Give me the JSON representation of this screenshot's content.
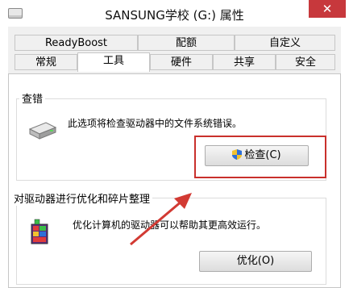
{
  "window": {
    "title": "SANSUNG学校 (G:) 属性",
    "close_label": "✕"
  },
  "tabs_row1": [
    "ReadyBoost",
    "配额",
    "自定义"
  ],
  "tabs_row2": [
    "常规",
    "工具",
    "硬件",
    "共享",
    "安全"
  ],
  "check": {
    "group_title": "查错",
    "description": "此选项将检查驱动器中的文件系统错误。",
    "button_label": "检查(C)"
  },
  "optimize": {
    "group_title": "对驱动器进行优化和碎片整理",
    "description": "优化计算机的驱动器可以帮助其更高效运行。",
    "button_label": "优化(O)"
  },
  "colors": {
    "accent_close": "#c7383c",
    "annotation_red": "#c9302c"
  },
  "icons": [
    "drive-icon",
    "shield-icon",
    "defrag-icon",
    "close-icon"
  ]
}
